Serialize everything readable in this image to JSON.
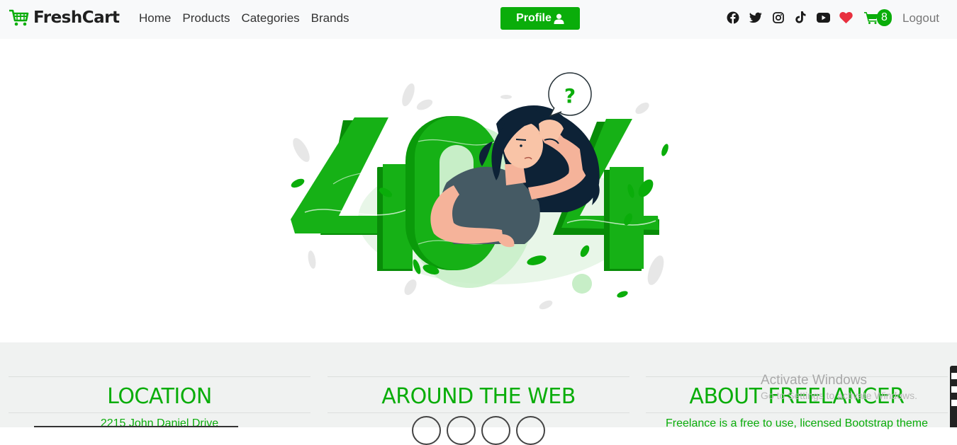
{
  "nav": {
    "brand": "FreshCart",
    "links": [
      "Home",
      "Products",
      "Categories",
      "Brands"
    ],
    "profile_label": "Profile",
    "cart_count": "8",
    "logout_label": "Logout",
    "social_icons": [
      "facebook-icon",
      "twitter-icon",
      "instagram-icon",
      "tiktok-icon",
      "youtube-icon",
      "heart-icon"
    ]
  },
  "hero": {
    "illustration": "404 not found illustration",
    "error_code": "404"
  },
  "footer": {
    "location_title": "LOCATION",
    "location_text": "2215 John Daniel Drive",
    "web_title": "AROUND THE WEB",
    "about_title": "ABOUT FREELANCER",
    "about_text": "Freelance is a free to use, licensed Bootstrap theme"
  },
  "overlay": {
    "activate_title": "Activate Windows",
    "activate_sub": "Go to Settings to activate Windows."
  },
  "colors": {
    "accent": "#0aad0a",
    "navbar_bg": "#f8f9fa",
    "footer_bg": "#f0f2f1"
  }
}
